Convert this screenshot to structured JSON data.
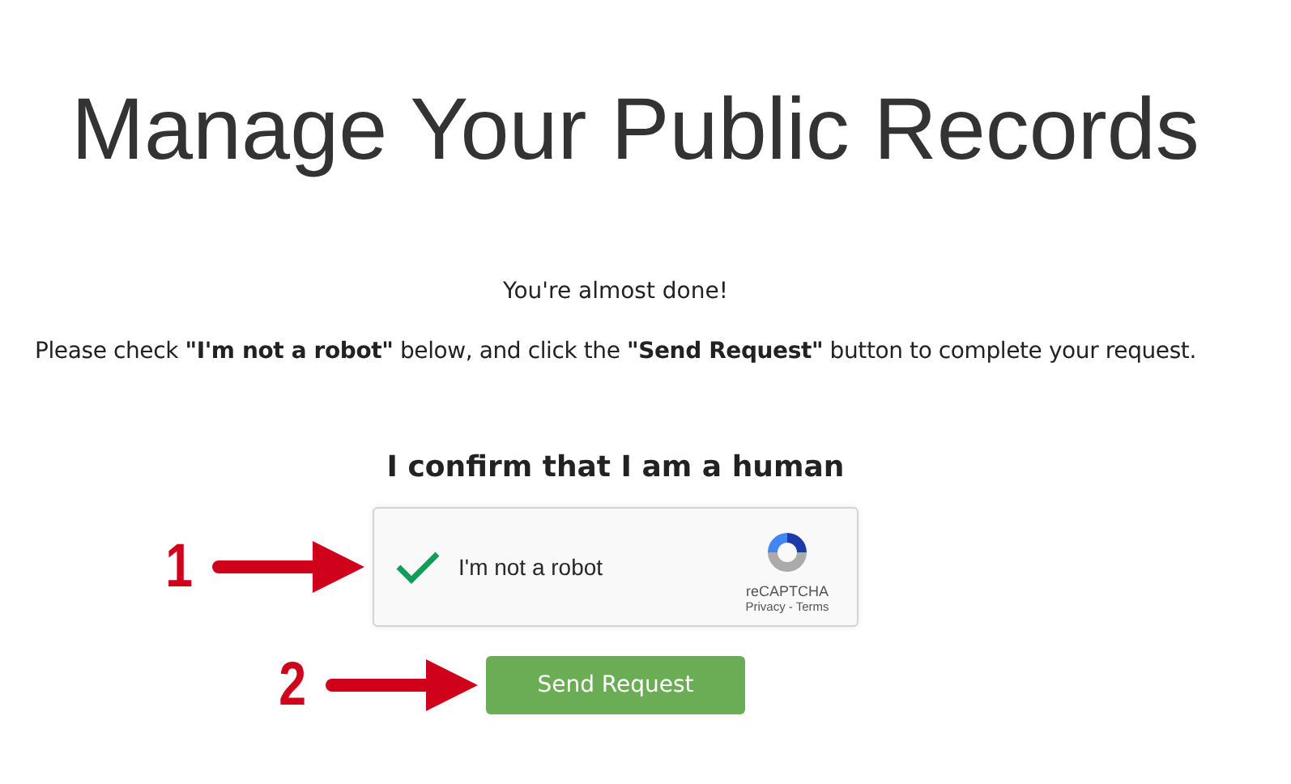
{
  "title": "Manage Your Public Records",
  "subtitle": "You're almost done!",
  "instruction": "Please check **\"I'm not a robot\"** below, and click the **\"Send Request\"** button to complete your request.",
  "heading": "I confirm that I am a human",
  "captcha": {
    "label": "I'm not a robot",
    "checked": true,
    "brand": "reCAPTCHA",
    "privacy": "Privacy",
    "separator": "-",
    "terms": "Terms"
  },
  "button": "Send Request",
  "steps": [
    "1",
    "2"
  ]
}
